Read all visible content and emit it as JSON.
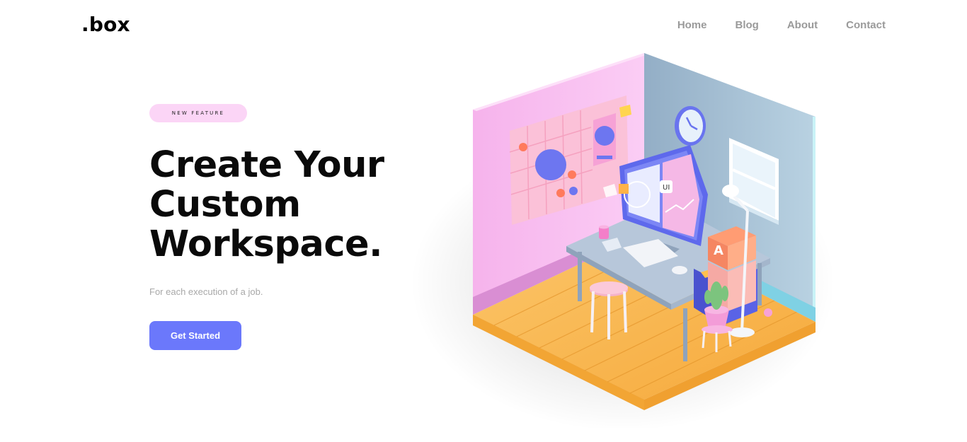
{
  "header": {
    "logo": ".box",
    "nav": [
      "Home",
      "Blog",
      "About",
      "Contact"
    ]
  },
  "hero": {
    "badge": "NEW FEATURE",
    "headline": [
      "Create Your",
      "Custom",
      "Workspace."
    ],
    "subtext": "For each execution of a job.",
    "cta_label": "Get Started",
    "illustration_text": {
      "monitor_label": "UI",
      "box_letter": "A"
    }
  },
  "colors": {
    "accent": "#6b78fb",
    "badge_bg": "#fbd5f6",
    "nav_text": "#9a9a9a",
    "wall_left": "#f6b6ef",
    "wall_right": "#a6bfd3",
    "floor": "#f7b24a"
  }
}
